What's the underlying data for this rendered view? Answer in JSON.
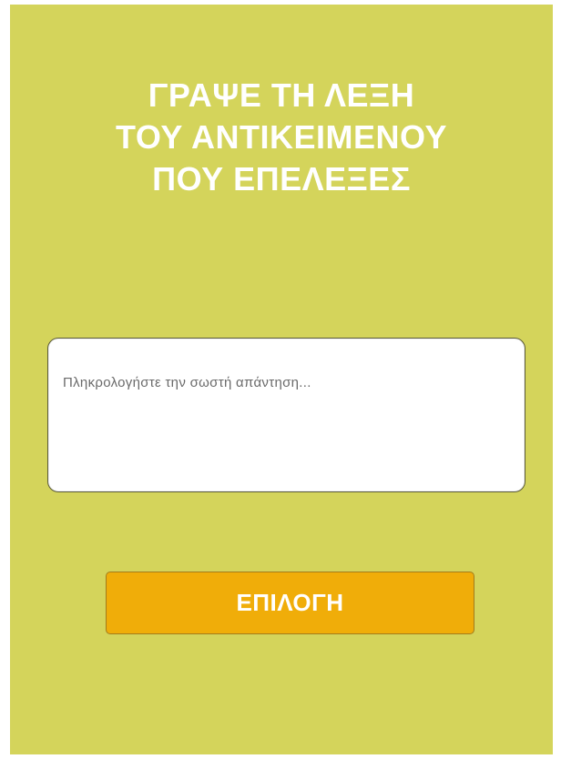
{
  "screen": {
    "background_color": "#d4d45b",
    "title_lines": [
      "ΓΡΑΨΕ ΤΗ ΛΕΞΗ",
      "ΤΟΥ ΑΝΤΙΚΕΙΜΕΝΟΥ",
      "ΠΟΥ ΕΠΕΛΕΞΕΣ"
    ]
  },
  "answer": {
    "placeholder": "Πληκρολογήστε την σωστή απάντηση...",
    "value": ""
  },
  "submit": {
    "label": "ΕΠΙΛΟΓΗ",
    "color": "#f0ad09"
  }
}
